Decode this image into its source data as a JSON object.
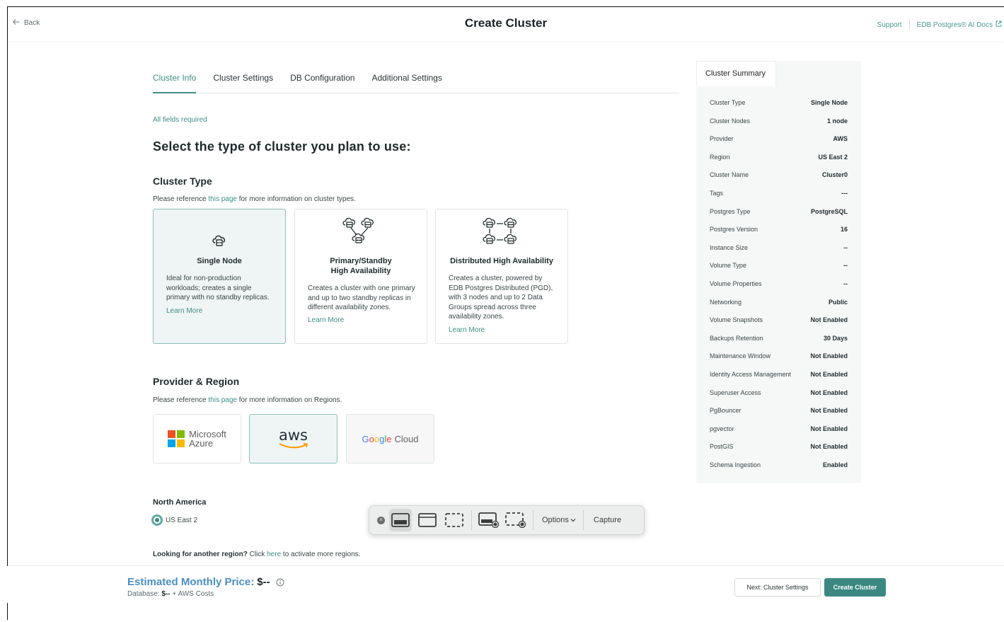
{
  "header": {
    "back_label": "Back",
    "title": "Create Cluster",
    "support_link": "Support",
    "docs_link": "EDB Postgres® AI Docs"
  },
  "tabs": [
    {
      "label": "Cluster Info",
      "active": true
    },
    {
      "label": "Cluster Settings",
      "active": false
    },
    {
      "label": "DB Configuration",
      "active": false
    },
    {
      "label": "Additional Settings",
      "active": false
    }
  ],
  "form": {
    "fields_required": "All fields required",
    "heading": "Select the type of cluster you plan to use:",
    "cluster_type": {
      "heading": "Cluster Type",
      "ref_prefix": "Please reference ",
      "ref_link": "this page",
      "ref_suffix": " for more information on cluster types.",
      "options": [
        {
          "title": "Single Node",
          "description": "Ideal for non-production workloads; creates a single primary with no standby replicas.",
          "learn_more": "Learn More",
          "selected": true
        },
        {
          "title": "Primary/Standby\nHigh Availability",
          "description": "Creates a cluster with one primary and up to two standby replicas in different availability zones.",
          "learn_more": "Learn More",
          "selected": false
        },
        {
          "title": "Distributed High Availability",
          "description": "Creates a cluster, powered by EDB Postgres Distributed (PGD), with 3 nodes and up to 2 Data Groups spread across three availability zones.",
          "learn_more": "Learn More",
          "selected": false
        }
      ]
    },
    "provider_region": {
      "heading": "Provider & Region",
      "ref_prefix": "Please reference ",
      "ref_link": "this page",
      "ref_suffix": " for more information on Regions.",
      "providers": [
        {
          "line1": "Microsoft",
          "line2": "Azure",
          "selected": false
        },
        {
          "name": "aws",
          "selected": true
        },
        {
          "google": "Google",
          "cloud": "Cloud",
          "selected": false
        }
      ],
      "region_group": "North America",
      "region": "US East 2",
      "another_bold": "Looking for another region?",
      "another_click": " Click ",
      "another_link": "here",
      "another_suffix": " to activate more regions."
    }
  },
  "summary": {
    "tab_label": "Cluster Summary",
    "rows": [
      {
        "key": "Cluster Type",
        "value": "Single Node"
      },
      {
        "key": "Cluster Nodes",
        "value": "1 node"
      },
      {
        "key": "Provider",
        "value": "AWS"
      },
      {
        "key": "Region",
        "value": "US East 2"
      },
      {
        "key": "Cluster Name",
        "value": "Cluster0"
      },
      {
        "key": "Tags",
        "value": "---"
      },
      {
        "key": "Postgres Type",
        "value": "PostgreSQL"
      },
      {
        "key": "Postgres Version",
        "value": "16"
      },
      {
        "key": "Instance Size",
        "value": "--"
      },
      {
        "key": "Volume Type",
        "value": "--"
      },
      {
        "key": "Volume Properties",
        "value": "--"
      },
      {
        "key": "Networking",
        "value": "Public"
      },
      {
        "key": "Volume Snapshots",
        "value": "Not Enabled"
      },
      {
        "key": "Backups Retention",
        "value": "30 Days"
      },
      {
        "key": "Maintenance Window",
        "value": "Not Enabled"
      },
      {
        "key": "Identity Access Management",
        "value": "Not Enabled"
      },
      {
        "key": "Superuser Access",
        "value": "Not Enabled"
      },
      {
        "key": "PgBouncer",
        "value": "Not Enabled"
      },
      {
        "key": "pgvector",
        "value": "Not Enabled"
      },
      {
        "key": "PostGIS",
        "value": "Not Enabled"
      },
      {
        "key": "Schema Ingestion",
        "value": "Enabled"
      }
    ]
  },
  "toolbar": {
    "options_label": "Options",
    "capture_label": "Capture"
  },
  "footer": {
    "price_label": "Estimated Monthly Price:",
    "price_value": "$--",
    "db_label": "Database: ",
    "db_value": "$--",
    "db_suffix": " + AWS Costs",
    "next_button": "Next: Cluster Settings",
    "create_button": "Create Cluster"
  },
  "colors": {
    "accent": "#3e8f88",
    "price_blue": "#4a8fc4",
    "selected_bg": "#eef5f4"
  }
}
